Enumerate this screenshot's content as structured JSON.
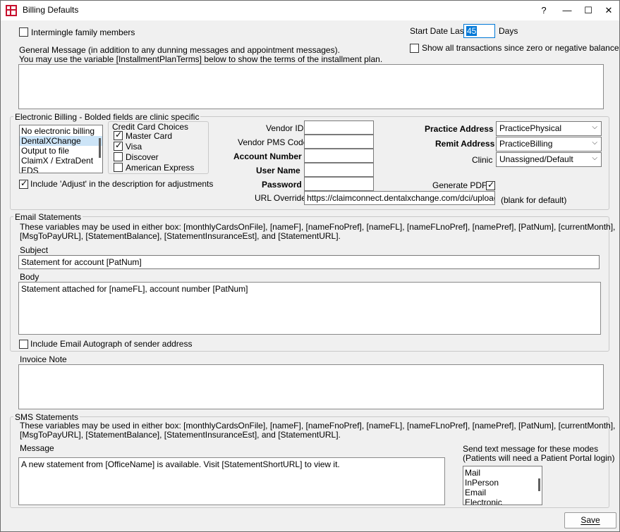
{
  "window": {
    "title": "Billing Defaults",
    "help_glyph": "?",
    "min_glyph": "—",
    "max_glyph": "☐",
    "close_glyph": "✕"
  },
  "top": {
    "intermingle_label": "Intermingle family members",
    "intermingle_checked": false,
    "start_date_label": "Start Date Last",
    "start_date_value": "45",
    "days_label": "Days",
    "show_all_label": "Show all transactions since zero or negative balance",
    "show_all_checked": false,
    "general_message_line1": "General Message (in addition to any dunning messages and appointment messages).",
    "general_message_line2": "You may use the variable [InstallmentPlanTerms] below to show the terms of the installment plan.",
    "general_message_value": ""
  },
  "electronic_billing": {
    "group_title": "Electronic Billing - Bolded fields are clinic specific",
    "options": [
      "No electronic billing",
      "DentalXChange",
      "Output to file",
      "ClaimX / ExtraDent",
      "EDS"
    ],
    "selected_index": 1,
    "credit_cards": {
      "title": "Credit Card Choices",
      "items": [
        {
          "label": "Master Card",
          "checked": true
        },
        {
          "label": "Visa",
          "checked": true
        },
        {
          "label": "Discover",
          "checked": false
        },
        {
          "label": "American Express",
          "checked": false
        }
      ]
    },
    "include_adjust_label": "Include 'Adjust' in the description for adjustments",
    "include_adjust_checked": true,
    "vendor_id_label": "Vendor ID",
    "vendor_id_value": "",
    "vendor_pms_label": "Vendor PMS Code",
    "vendor_pms_value": "",
    "account_number_label": "Account Number",
    "account_number_value": "",
    "user_name_label": "User Name",
    "user_name_value": "",
    "password_label": "Password",
    "password_value": "",
    "url_override_label": "URL Override",
    "url_override_value": "https://claimconnect.dentalxchange.com/dci/upload.sv",
    "blank_default_label": "(blank for default)",
    "practice_address_label": "Practice Address",
    "practice_address_value": "PracticePhysical",
    "remit_address_label": "Remit Address",
    "remit_address_value": "PracticeBilling",
    "clinic_label": "Clinic",
    "clinic_value": "Unassigned/Default",
    "generate_pdf_label": "Generate PDF",
    "generate_pdf_checked": true
  },
  "email_statements": {
    "group_title": "Email Statements",
    "variables_line1": "These variables may be used in either box: [monthlyCardsOnFile], [nameF], [nameFnoPref], [nameFL], [nameFLnoPref], [namePref], [PatNum], [currentMonth],",
    "variables_line2": "[MsgToPayURL], [StatementBalance], [StatementInsuranceEst], and [StatementURL].",
    "subject_label": "Subject",
    "subject_value": "Statement for account [PatNum]",
    "body_label": "Body",
    "body_value": "Statement attached for [nameFL], account number [PatNum]",
    "autograph_label": "Include Email Autograph of sender address",
    "autograph_checked": false
  },
  "invoice": {
    "label": "Invoice Note",
    "value": ""
  },
  "sms_statements": {
    "group_title": "SMS Statements",
    "variables_line1": "These variables may be used in either box: [monthlyCardsOnFile], [nameF], [nameFnoPref], [nameFL], [nameFLnoPref], [namePref], [PatNum], [currentMonth],",
    "variables_line2": "[MsgToPayURL], [StatementBalance], [StatementInsuranceEst], and [StatementURL].",
    "message_label": "Message",
    "message_value": "A new statement from [OfficeName] is available. Visit [StatementShortURL] to view it.",
    "modes_label_line1": "Send text message for these modes",
    "modes_label_line2": "(Patients will need a Patient Portal login)",
    "modes": [
      "Mail",
      "InPerson",
      "Email",
      "Electronic"
    ]
  },
  "footer": {
    "save_label": "Save"
  }
}
